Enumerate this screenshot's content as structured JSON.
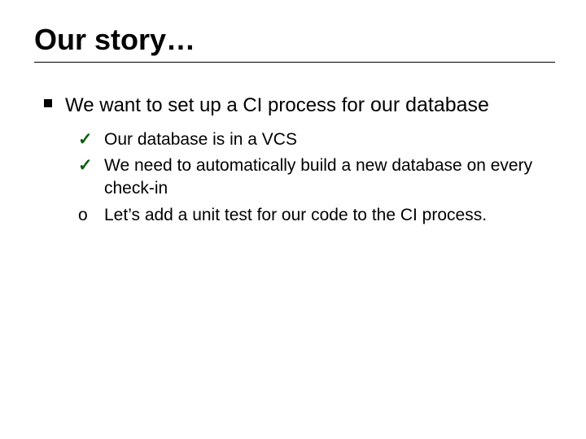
{
  "title": "Our story…",
  "bullet": {
    "text_prefix": "We want to set up a CI process fo",
    "text_emph": "r our database"
  },
  "subs": [
    {
      "marker": "✓",
      "marker_class": "check",
      "text": "Our database is in a VCS"
    },
    {
      "marker": "✓",
      "marker_class": "check",
      "text": "We need to automatically build a new database on every check-in"
    },
    {
      "marker": "o",
      "marker_class": "",
      "text": "Let’s add a unit test for our code to the CI process."
    }
  ]
}
